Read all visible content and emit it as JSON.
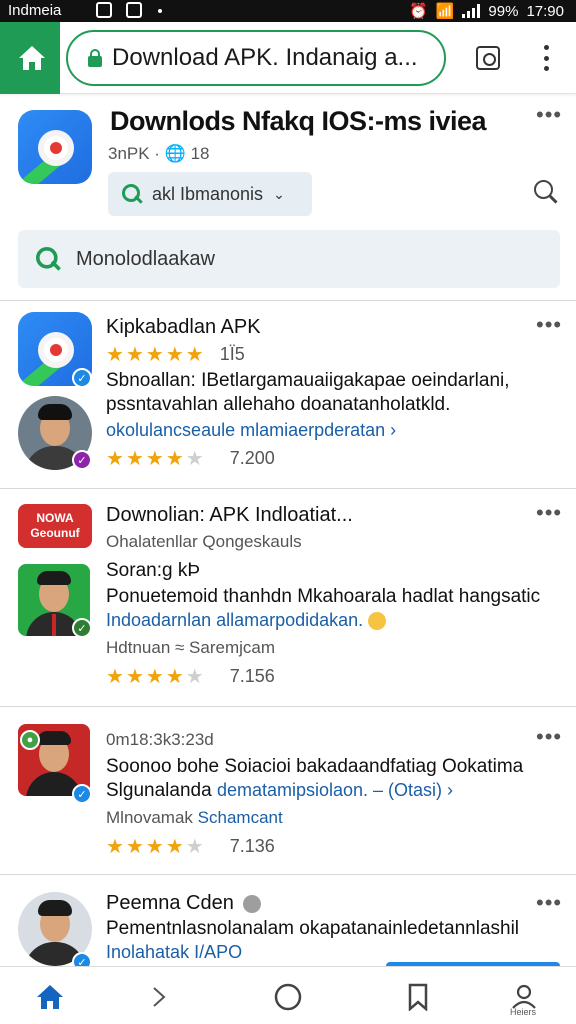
{
  "status_bar": {
    "carrier": "Indmeia",
    "battery": "99%",
    "time": "17:90"
  },
  "browser": {
    "url_text": "Download APK. Indanaig a..."
  },
  "app_header": {
    "title": "Downlods Nfakq IOS:-ms iviea",
    "meta": "3nPK · 🌐 18",
    "chip_label": "akl Ibmanonis"
  },
  "search": {
    "placeholder": "Monolodlaakaw"
  },
  "results": [
    {
      "title": "Kipkabadlan APK",
      "rating_count": "1Ï5",
      "description": "Sbnoallan: IBetlargamauaiigakapae oeindarlani,",
      "description2": "pssntavahlan allehaho doanatanholatkld.",
      "link": "okolulancseaule mlamiaerpderatan ›",
      "rating2_count": "7.200"
    },
    {
      "title": "Downolian: APK  Indloatiat...",
      "logo_text": "NOWA Geounuf",
      "subtitle": "Ohalatenllar Qongeskauls",
      "author": "Soran:g kÞ",
      "description": "Ponuetemoid thanhdn Mkahoarala hadlat hangsatic",
      "link": "Indoadarnlan allamarpodidakan.",
      "meta": "Hdtnuan ≈ Saremjcam",
      "rating_count": "7.156"
    },
    {
      "title": "0m18:3k3:23d",
      "description": "Soonoo bohe Soiacioi bakadaandfatiag Ookatima",
      "description_prefix": "Slgunalanda",
      "link": "dematamipsiolaon. – (Otasi) ›",
      "meta_prefix": "Mlnovamak",
      "meta_link": "Schamcant",
      "rating_count": "7.136"
    },
    {
      "title": "Peemna Cden",
      "description": "Pementnlasnolanalam okapatanainledetannlashil",
      "link": "Inolahatak I/APO"
    }
  ],
  "bottom_nav": {
    "profile_label": "Heiers"
  },
  "colors": {
    "accent_green": "#1f9b55",
    "link_blue": "#1a5fa8",
    "star": "#f0a30a",
    "nav_blue": "#1565c0"
  }
}
